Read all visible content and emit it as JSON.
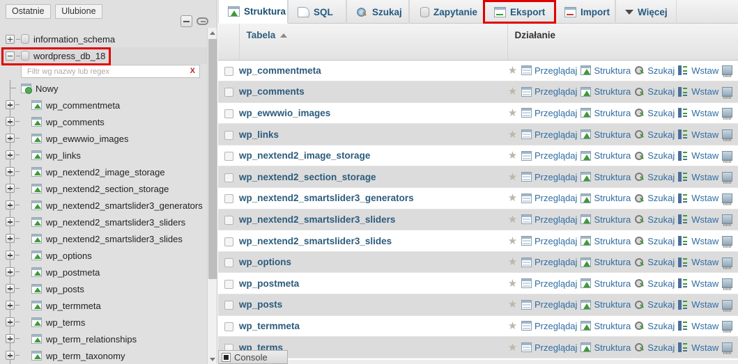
{
  "sidebar": {
    "mini_tabs": [
      {
        "label": "Ostatnie",
        "name": "tab-recent"
      },
      {
        "label": "Ulubione",
        "name": "tab-favorites"
      }
    ],
    "icons": {
      "collapse_all": "collapse-all-icon",
      "link_toggle": "link-icon"
    },
    "filter": {
      "placeholder": "Filtr wg nazwy lub regex",
      "value": "",
      "clear_label": "X"
    },
    "new_label": "Nowy",
    "databases": [
      {
        "label": "information_schema",
        "expanded": false
      },
      {
        "label": "wordpress_db_18",
        "expanded": true,
        "highlighted": true
      }
    ],
    "tables": [
      "wp_commentmeta",
      "wp_comments",
      "wp_ewwwio_images",
      "wp_links",
      "wp_nextend2_image_storage",
      "wp_nextend2_section_storage",
      "wp_nextend2_smartslider3_generators",
      "wp_nextend2_smartslider3_sliders",
      "wp_nextend2_smartslider3_slides",
      "wp_options",
      "wp_postmeta",
      "wp_posts",
      "wp_termmeta",
      "wp_terms",
      "wp_term_relationships",
      "wp_term_taxonomy"
    ]
  },
  "tabs": [
    {
      "label": "Struktura",
      "icon": "structure-icon",
      "active": true,
      "highlighted": false
    },
    {
      "label": "SQL",
      "icon": "sql-icon",
      "active": false,
      "highlighted": false
    },
    {
      "label": "Szukaj",
      "icon": "search-icon",
      "active": false,
      "highlighted": false
    },
    {
      "label": "Zapytanie",
      "icon": "query-icon",
      "active": false,
      "highlighted": false
    },
    {
      "label": "Eksport",
      "icon": "export-icon",
      "active": false,
      "highlighted": true
    },
    {
      "label": "Import",
      "icon": "import-icon",
      "active": false,
      "highlighted": false
    },
    {
      "label": "Więcej",
      "icon": "chevron-down-icon",
      "active": false,
      "highlighted": false
    }
  ],
  "table": {
    "headers": {
      "checkbox": "",
      "name": "Tabela",
      "sort": "ascending",
      "action": "Działanie"
    },
    "action_labels": {
      "favorite": "favorite-star-icon",
      "browse": "Przeglądaj",
      "structure": "Struktura",
      "search": "Szukaj",
      "insert": "Wstaw",
      "empty": "empty-icon"
    },
    "rows": [
      {
        "name": "wp_commentmeta"
      },
      {
        "name": "wp_comments"
      },
      {
        "name": "wp_ewwwio_images"
      },
      {
        "name": "wp_links"
      },
      {
        "name": "wp_nextend2_image_storage"
      },
      {
        "name": "wp_nextend2_section_storage"
      },
      {
        "name": "wp_nextend2_smartslider3_generators"
      },
      {
        "name": "wp_nextend2_smartslider3_sliders"
      },
      {
        "name": "wp_nextend2_smartslider3_slides"
      },
      {
        "name": "wp_options"
      },
      {
        "name": "wp_postmeta"
      },
      {
        "name": "wp_posts"
      },
      {
        "name": "wp_termmeta"
      },
      {
        "name": "wp_terms"
      }
    ]
  },
  "console": {
    "label": "Console"
  },
  "colors": {
    "highlight_box": "#e10000",
    "link": "#2f6da3",
    "table_name_link": "#2b5b7d",
    "tab_text": "#235a81",
    "row_even_bg": "#dcdcdc",
    "row_odd_bg": "#ffffff",
    "sidebar_bg": "#e0e0e0"
  }
}
